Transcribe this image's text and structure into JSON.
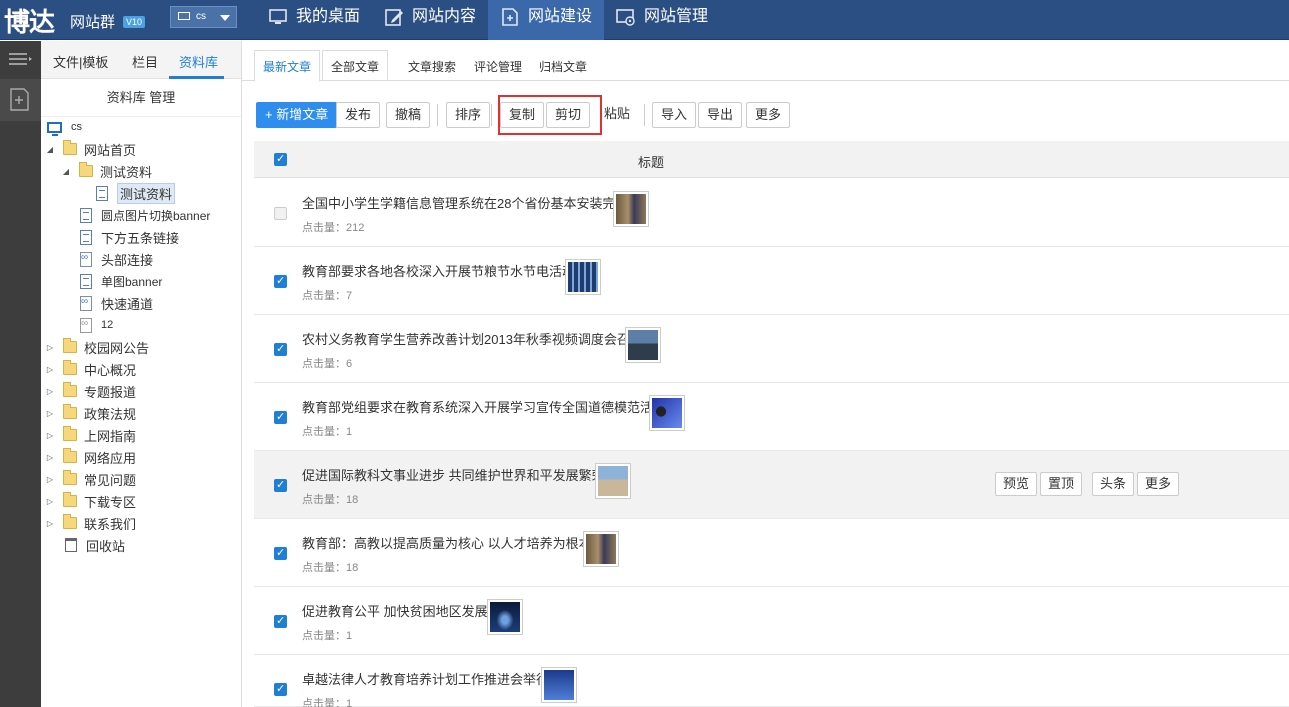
{
  "header": {
    "logo": "博达",
    "logo_sub": "网站群",
    "version": "V10",
    "site_select": "cs",
    "nav": [
      {
        "label": "我的桌面",
        "icon": "monitor-icon"
      },
      {
        "label": "网站内容",
        "icon": "edit-icon"
      },
      {
        "label": "网站建设",
        "icon": "add-page-icon"
      },
      {
        "label": "网站管理",
        "icon": "settings-monitor-icon"
      }
    ]
  },
  "sidebar": {
    "tabs": [
      "文件|模板",
      "栏目",
      "资料库"
    ],
    "heading": "资料库 管理",
    "tree": [
      {
        "label": "cs",
        "icon": "monitor-icon"
      },
      {
        "label": "网站首页",
        "icon": "folder-icon"
      },
      {
        "label": "测试资料",
        "icon": "folder-icon"
      },
      {
        "label": "测试资料",
        "icon": "document-icon"
      },
      {
        "label": "圆点图片切换banner",
        "icon": "document-icon"
      },
      {
        "label": "下方五条链接",
        "icon": "document-icon"
      },
      {
        "label": "头部连接",
        "icon": "link-document-icon"
      },
      {
        "label": "单图banner",
        "icon": "document-icon"
      },
      {
        "label": "快速通道",
        "icon": "link-document-icon"
      },
      {
        "label": "12",
        "icon": "link-document-icon"
      },
      {
        "label": "校园网公告",
        "icon": "folder-icon"
      },
      {
        "label": "中心概况",
        "icon": "folder-icon"
      },
      {
        "label": "专题报道",
        "icon": "folder-icon"
      },
      {
        "label": "政策法规",
        "icon": "folder-icon"
      },
      {
        "label": "上网指南",
        "icon": "folder-icon"
      },
      {
        "label": "网络应用",
        "icon": "folder-icon"
      },
      {
        "label": "常见问题",
        "icon": "folder-icon"
      },
      {
        "label": "下载专区",
        "icon": "folder-icon"
      },
      {
        "label": "联系我们",
        "icon": "folder-icon"
      },
      {
        "label": "回收站",
        "icon": "trash-icon"
      }
    ]
  },
  "main": {
    "tabs": [
      "最新文章",
      "全部文章",
      "文章搜索",
      "评论管理",
      "归档文章"
    ],
    "toolbar": {
      "new": "+ 新增文章",
      "publish": "发布",
      "withdraw": "撤稿",
      "sort": "排序",
      "copy": "复制",
      "cut": "剪切",
      "paste": "粘贴",
      "import": "导入",
      "export": "导出",
      "more": "更多"
    },
    "table_header": "标题",
    "click_label": "点击量：",
    "rows": [
      {
        "title": "全国中小学生学籍信息管理系统在28个省份基本安装完毕",
        "clicks": "212",
        "checked": false
      },
      {
        "title": "教育部要求各地各校深入开展节粮节水节电活动",
        "clicks": "7",
        "checked": true
      },
      {
        "title": "农村义务教育学生营养改善计划2013年秋季视频调度会召开",
        "clicks": "6",
        "checked": true
      },
      {
        "title": "教育部党组要求在教育系统深入开展学习宣传全国道德模范活动",
        "clicks": "1",
        "checked": true
      },
      {
        "title": "促进国际教科文事业进步 共同维护世界和平发展繁荣",
        "clicks": "18",
        "checked": true
      },
      {
        "title": "教育部：高教以提高质量为核心 以人才培养为根本",
        "clicks": "18",
        "checked": true
      },
      {
        "title": "促进教育公平 加快贫困地区发展",
        "clicks": "1",
        "checked": true
      },
      {
        "title": "卓越法律人才教育培养计划工作推进会举行",
        "clicks": "1",
        "checked": true
      }
    ],
    "row_actions": [
      "预览",
      "置顶",
      "头条",
      "更多"
    ]
  }
}
